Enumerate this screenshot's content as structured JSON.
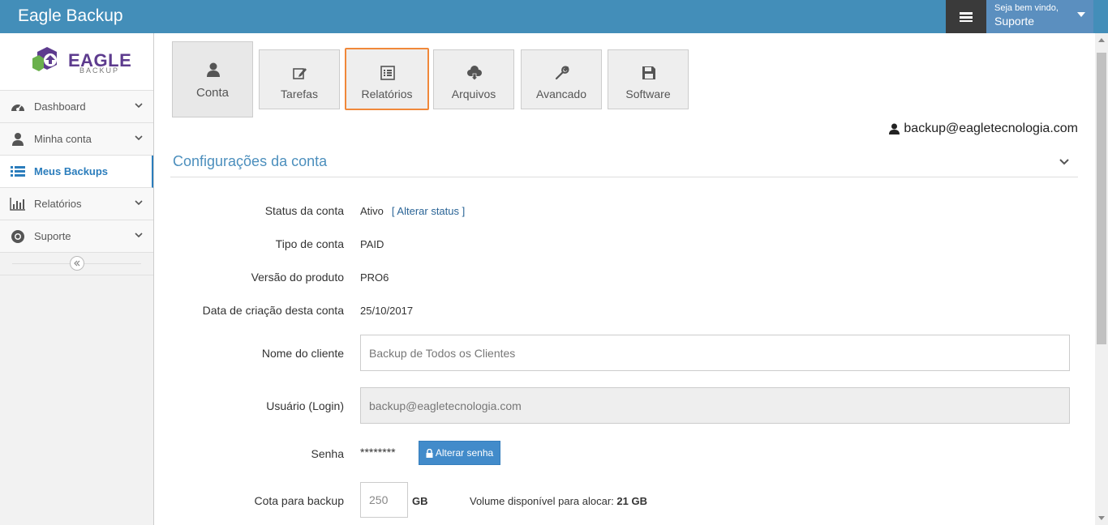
{
  "header": {
    "app_title": "Eagle Backup",
    "welcome": "Seja bem vindo,",
    "user_name": "Suporte"
  },
  "sidebar": {
    "logo_text": "EAGLE",
    "logo_sub": "BACKUP",
    "items": [
      {
        "label": "Dashboard",
        "icon": "dashboard-icon"
      },
      {
        "label": "Minha conta",
        "icon": "user-icon"
      },
      {
        "label": "Meus Backups",
        "icon": "list-icon"
      },
      {
        "label": "Relatórios",
        "icon": "bar-chart-icon"
      },
      {
        "label": "Suporte",
        "icon": "life-ring-icon"
      }
    ]
  },
  "tabs": [
    {
      "label": "Conta",
      "icon": "user-icon"
    },
    {
      "label": "Tarefas",
      "icon": "edit-icon"
    },
    {
      "label": "Relatórios",
      "icon": "list-alt-icon"
    },
    {
      "label": "Arquivos",
      "icon": "cloud-download-icon"
    },
    {
      "label": "Avancado",
      "icon": "wrench-icon"
    },
    {
      "label": "Software",
      "icon": "floppy-icon"
    }
  ],
  "account_email": "backup@eagletecnologia.com",
  "section_title": "Configurações da conta",
  "form": {
    "status_label": "Status da conta",
    "status_value": "Ativo",
    "status_link": "[ Alterar status ]",
    "tipo_label": "Tipo de conta",
    "tipo_value": "PAID",
    "versao_label": "Versão do produto",
    "versao_value": "PRO6",
    "data_label": "Data de criação desta conta",
    "data_value": "25/10/2017",
    "nome_label": "Nome do cliente",
    "nome_value": "Backup de Todos os Clientes",
    "usuario_label": "Usuário (Login)",
    "usuario_value": "backup@eagletecnologia.com",
    "senha_label": "Senha",
    "senha_value": "********",
    "senha_button": "Alterar senha",
    "cota_label": "Cota para backup",
    "cota_value": "250",
    "cota_unit": "GB",
    "volume_label": "Volume disponível para alocar:",
    "volume_value": "21 GB"
  },
  "colors": {
    "topbar": "#438eb9",
    "accent": "#2b7dbc",
    "highlight": "#f0883a",
    "button": "#428bca"
  }
}
